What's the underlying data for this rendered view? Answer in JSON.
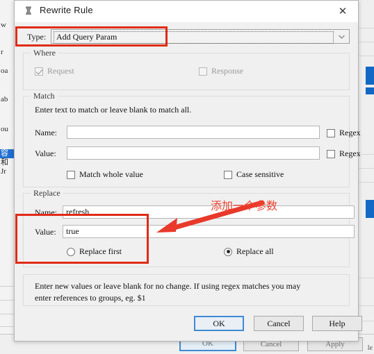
{
  "window": {
    "title": "Rewrite Rule",
    "icon": "charles-proxy-icon",
    "close_label": "✕"
  },
  "type_row": {
    "label": "Type:",
    "selected": "Add Query Param",
    "dropdown_icon": "chevron-down-icon"
  },
  "where": {
    "legend": "Where",
    "request": {
      "label": "Request",
      "checked": true,
      "enabled": false
    },
    "response": {
      "label": "Response",
      "checked": false,
      "enabled": false
    }
  },
  "match": {
    "legend": "Match",
    "help": "Enter text to match or leave blank to match all.",
    "name": {
      "label": "Name:",
      "value": "",
      "regex_label": "Regex",
      "regex_checked": false
    },
    "value": {
      "label": "Value:",
      "value": "",
      "regex_label": "Regex",
      "regex_checked": false
    },
    "match_whole_value": {
      "label": "Match whole value",
      "checked": false
    },
    "case_sensitive": {
      "label": "Case sensitive",
      "checked": false
    }
  },
  "replace": {
    "legend": "Replace",
    "name": {
      "label": "Name:",
      "value": "refresh"
    },
    "value": {
      "label": "Value:",
      "value": "true"
    },
    "replace_first": {
      "label": "Replace first",
      "selected": false
    },
    "replace_all": {
      "label": "Replace all",
      "selected": true
    }
  },
  "hint": {
    "line1": "Enter new values or leave blank for no change.  If using regex matches you may",
    "line2": "enter references to groups, eg. $1"
  },
  "footer": {
    "ok": "OK",
    "cancel": "Cancel",
    "help": "Help"
  },
  "annotation": {
    "text": "添加一个参数",
    "color": "#e8392a",
    "box_color": "#e02b16",
    "arrow_icon": "arrow-pointing-left-icon"
  },
  "background": {
    "left_fragments": [
      "w",
      "r",
      "oa",
      "ab",
      "ou",
      "容",
      "和",
      "Jr"
    ],
    "buttons": {
      "ok": "OK",
      "cancel": "Cancel",
      "apply": "Apply"
    },
    "tail_text": "le"
  }
}
